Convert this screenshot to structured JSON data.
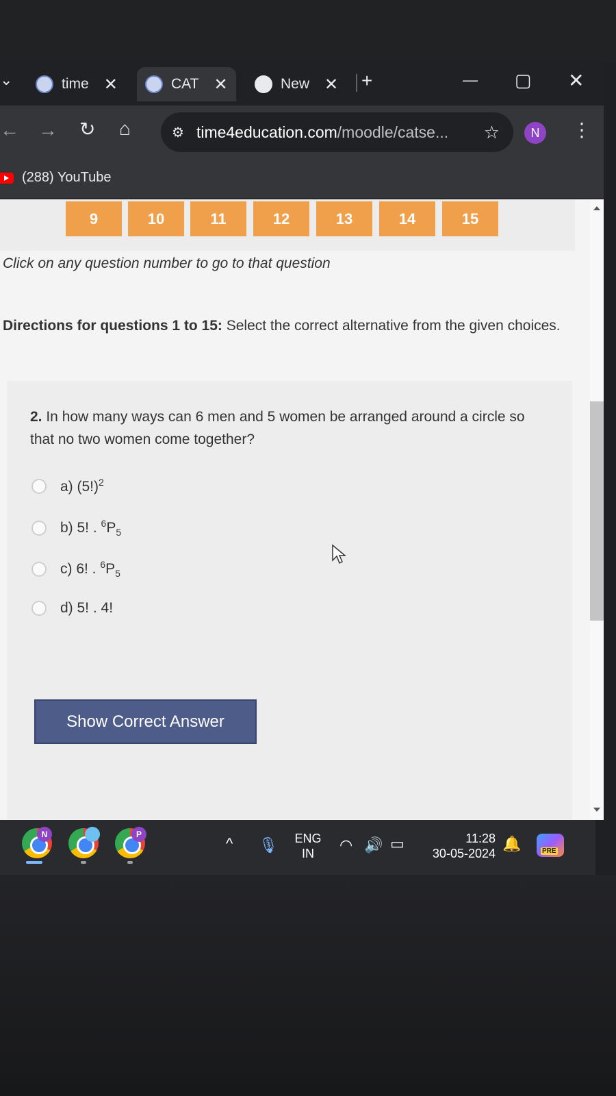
{
  "browser": {
    "tabs": [
      {
        "label": "time",
        "close": "✕"
      },
      {
        "label": "CAT",
        "close": "✕"
      },
      {
        "label": "New",
        "close": "✕"
      }
    ],
    "new_tab": "+",
    "window_controls": {
      "minimize": "—",
      "maximize": "▢",
      "close": "✕"
    },
    "address": {
      "domain": "time4education.com",
      "path": "/moodle/catse..."
    },
    "profile_initial": "N",
    "bookmark": {
      "label": "(288) YouTube"
    }
  },
  "quiz": {
    "question_numbers": [
      "9",
      "10",
      "11",
      "12",
      "13",
      "14",
      "15"
    ],
    "hint": "Click on any question number to go to that question",
    "directions_label": "Directions for questions 1 to 15:",
    "directions_text": " Select the correct alternative from the given choices.",
    "question_number": "2.",
    "question_text": " In how many ways can 6 men and 5 women be arranged around a circle so that no two women come together?",
    "options": {
      "a": {
        "prefix": "a) (5!)",
        "sup": "2"
      },
      "b": {
        "prefix": "b) 5! . ",
        "sup": "6",
        "main": "P",
        "sub": "5"
      },
      "c": {
        "prefix": "c) 6! . ",
        "sup": "6",
        "main": "P",
        "sub": "5"
      },
      "d": {
        "prefix": "d) 5! . 4!"
      }
    },
    "show_answer_label": "Show Correct Answer"
  },
  "taskbar": {
    "app_badges": [
      "N",
      "",
      "P"
    ],
    "language": {
      "line1": "ENG",
      "line2": "IN"
    },
    "time": "11:28",
    "date": "30-05-2024",
    "copilot_badge": "PRE"
  },
  "colors": {
    "question_button": "#f0a04b",
    "show_button": "#4e5c8a"
  }
}
